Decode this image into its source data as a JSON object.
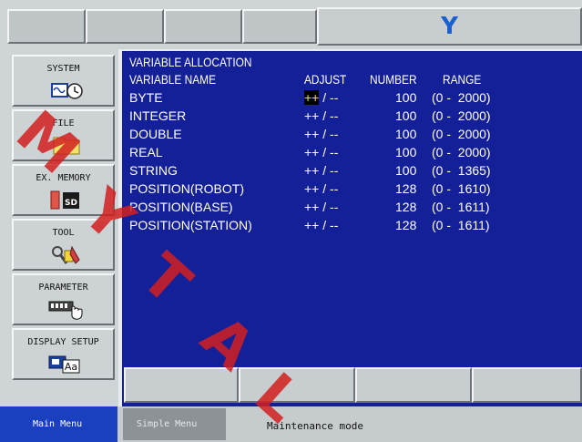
{
  "header": {
    "logo_letter": "Y"
  },
  "sidebar": {
    "items": [
      {
        "label": "SYSTEM"
      },
      {
        "label": "FILE"
      },
      {
        "label": "EX. MEMORY"
      },
      {
        "label": "TOOL"
      },
      {
        "label": "PARAMETER"
      },
      {
        "label": "DISPLAY SETUP"
      }
    ]
  },
  "main": {
    "title": "VARIABLE ALLOCATION",
    "columns": {
      "name": "VARIABLE NAME",
      "adjust": "ADJUST",
      "number": "NUMBER",
      "range": "RANGE"
    },
    "rows": [
      {
        "name": "BYTE",
        "adj_plus": "++",
        "adj_rest": " / --",
        "number": "100",
        "range": "(0 -  2000)"
      },
      {
        "name": "INTEGER",
        "adj_plus": "++",
        "adj_rest": " / --",
        "number": "100",
        "range": "(0 -  2000)"
      },
      {
        "name": "DOUBLE",
        "adj_plus": "++",
        "adj_rest": " / --",
        "number": "100",
        "range": "(0 -  2000)"
      },
      {
        "name": "REAL",
        "adj_plus": "++",
        "adj_rest": " / --",
        "number": "100",
        "range": "(0 -  2000)"
      },
      {
        "name": "STRING",
        "adj_plus": "++",
        "adj_rest": " / --",
        "number": "100",
        "range": "(0 -  1365)"
      },
      {
        "name": "POSITION(ROBOT)",
        "adj_plus": "++",
        "adj_rest": " / --",
        "number": "128",
        "range": "(0 -  1610)"
      },
      {
        "name": "POSITION(BASE)",
        "adj_plus": "++",
        "adj_rest": " / --",
        "number": "128",
        "range": "(0 -  1611)"
      },
      {
        "name": "POSITION(STATION)",
        "adj_plus": "++",
        "adj_rest": " / --",
        "number": "128",
        "range": "(0 -  1611)"
      }
    ]
  },
  "status": {
    "main_menu": "Main Menu",
    "simple_menu": "Simple Menu",
    "mode": "Maintenance mode"
  },
  "watermark": {
    "text": "MYTAL"
  },
  "colors": {
    "panel_bg": "#142098",
    "logo_blue": "#1a5fcf",
    "watermark_red": "#d21e1e"
  }
}
